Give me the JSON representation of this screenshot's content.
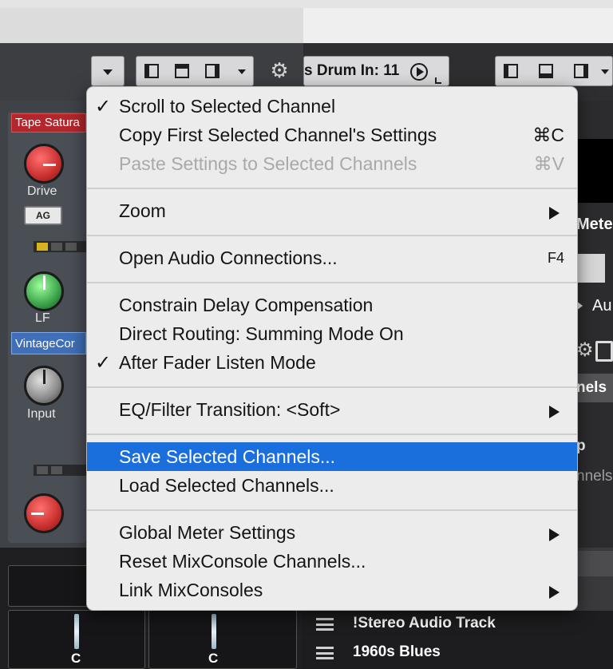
{
  "toolbar": {
    "input_label": "s Drum In: 11"
  },
  "channel_strip": {
    "insert_top": "Tape Satura",
    "knob_drive": "Drive",
    "ag_button": "AG",
    "knob_lf": "LF",
    "insert_eq": "VintageCor",
    "knob_input": "Input",
    "pan_left": "C",
    "pan_right": "C"
  },
  "right_side": {
    "meter_text": "Mete",
    "au_text": "Au",
    "nels_text": "nels",
    "p_text": "p",
    "nnels_text": "nnels",
    "tracks": [
      "!Stereo Audio Track",
      "1960s Blues"
    ]
  },
  "menu": {
    "items": [
      {
        "label": "Scroll to Selected Channel",
        "checked": true
      },
      {
        "label": "Copy First Selected Channel's Settings",
        "shortcut": "⌘C"
      },
      {
        "label": "Paste Settings to Selected Channels",
        "shortcut": "⌘V",
        "disabled": true
      },
      {
        "label": "Zoom",
        "submenu": true
      },
      {
        "label": "Open Audio Connections...",
        "shortcut": "F4"
      },
      {
        "label": "Constrain Delay Compensation"
      },
      {
        "label": "Direct Routing: Summing Mode On"
      },
      {
        "label": "After Fader Listen Mode",
        "checked": true
      },
      {
        "label": "EQ/Filter Transition: <Soft>",
        "submenu": true
      },
      {
        "label": "Save Selected Channels...",
        "highlighted": true
      },
      {
        "label": "Load Selected Channels..."
      },
      {
        "label": "Global Meter Settings",
        "submenu": true
      },
      {
        "label": "Reset MixConsole Channels..."
      },
      {
        "label": "Link MixConsoles",
        "submenu": true
      }
    ],
    "check_glyph": "✓"
  },
  "colors": {
    "highlight": "#1b6fdc",
    "insert_red": "#b3262b",
    "insert_blue": "#3f6fb8",
    "knob_red": "#c8302f",
    "knob_green": "#3ba24a"
  }
}
